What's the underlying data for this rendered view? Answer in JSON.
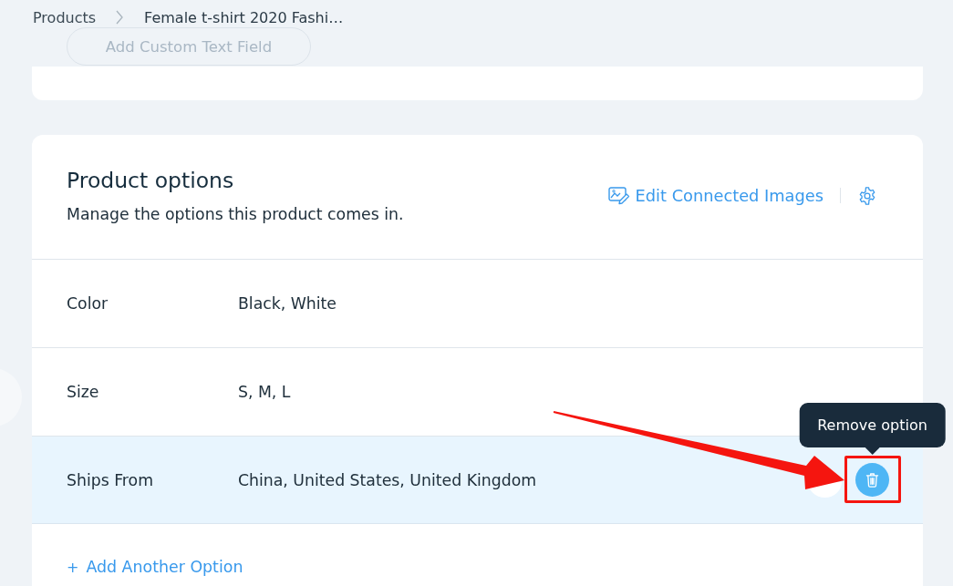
{
  "breadcrumb": [
    {
      "label": "Products"
    },
    {
      "label": "Female t-shirt 2020 Fashi…"
    }
  ],
  "top_card": {
    "button": "Add Custom Text Field"
  },
  "product_options": {
    "title": "Product options",
    "subtitle": "Manage the options this product comes in.",
    "edit_images_link": "Edit Connected Images",
    "options": [
      {
        "name": "Color",
        "values": "Black, White",
        "highlighted": false
      },
      {
        "name": "Size",
        "values": "S, M, L",
        "highlighted": false
      },
      {
        "name": "Ships From",
        "values": "China, United States, United Kingdom",
        "highlighted": true,
        "tooltip": "Remove option"
      }
    ],
    "add_option": {
      "icon": "+",
      "label": "Add Another Option"
    }
  }
}
